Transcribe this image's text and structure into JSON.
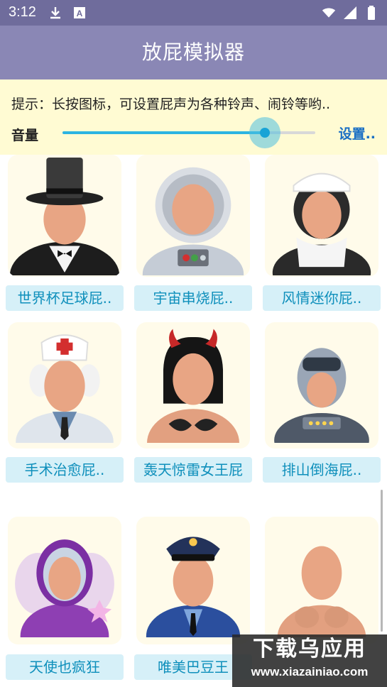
{
  "status_bar": {
    "time": "3:12",
    "icons_left": [
      "download-icon",
      "text-a-icon"
    ],
    "icons_right": [
      "wifi-icon",
      "signal-icon",
      "battery-icon"
    ]
  },
  "app_bar": {
    "title": "放屁模拟器"
  },
  "panel": {
    "tip": "提示：长按图标，可设置屁声为各种铃声、闹铃等哟..",
    "volume_label": "音量",
    "volume_fraction": 0.8,
    "settings_label": "设置.."
  },
  "tiles": [
    {
      "label": "世界杯足球屁..",
      "avatar": "top-hat-gentleman"
    },
    {
      "label": "宇宙串烧屁..",
      "avatar": "astronaut"
    },
    {
      "label": "风情迷你屁..",
      "avatar": "maid"
    },
    {
      "label": "手术治愈屁..",
      "avatar": "nurse"
    },
    {
      "label": "轰天惊雷女王屁",
      "avatar": "devil-woman"
    },
    {
      "label": "排山倒海屁..",
      "avatar": "robot"
    },
    {
      "label": "天使也疯狂",
      "avatar": "fairy"
    },
    {
      "label": "唯美巴豆王",
      "avatar": "policeman"
    },
    {
      "label": "",
      "avatar": "bare-figure"
    }
  ],
  "watermark": {
    "main": "下载乌应用",
    "sub": "www.xiazainiao.com"
  },
  "colors": {
    "status_bar": "#6f6c9c",
    "app_bar": "#8a87b5",
    "panel": "#fffbd3",
    "accent": "#18a3d6",
    "label_bg": "#d6f0f8",
    "label_text": "#0e8fbb"
  }
}
